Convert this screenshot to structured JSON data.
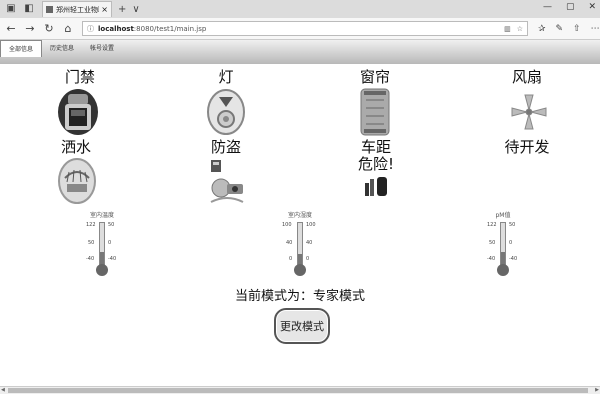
{
  "browser": {
    "tab_title": "郑州轻工业物联网Web...",
    "tab_close": "×",
    "tab_new": "+",
    "tab_menu": "∨",
    "win_min": "—",
    "win_max": "▢",
    "win_close": "✕",
    "url_host": "localhost",
    "url_rest": ":8080/test1/main.jsp"
  },
  "nav": {
    "items": [
      "全部信息",
      "历史信息",
      "帐号设置"
    ]
  },
  "devices": [
    {
      "label": "门禁",
      "icon": "lock-icon"
    },
    {
      "label": "灯",
      "icon": "lightbulb-icon"
    },
    {
      "label": "窗帘",
      "icon": "curtain-icon"
    },
    {
      "label": "风扇",
      "icon": "fan-icon"
    },
    {
      "label": "洒水",
      "icon": "sprinkler-icon"
    },
    {
      "label": "防盗",
      "icon": "burglar-icon"
    },
    {
      "label": "车距",
      "icon": "car-distance-icon",
      "status": "危险!"
    },
    {
      "label": "待开发",
      "icon": ""
    }
  ],
  "gauges": [
    {
      "title": "室内温度",
      "ticks_left": [
        "122",
        "50",
        "-40"
      ],
      "ticks_right": [
        "50",
        "0",
        "-40"
      ],
      "level": 0.35
    },
    {
      "title": "室内湿度",
      "ticks_left": [
        "100",
        "40",
        "0"
      ],
      "ticks_right": [
        "100",
        "40",
        "0"
      ],
      "level": 0.3
    },
    {
      "title": "pM值",
      "ticks_left": [
        "122",
        "50",
        "-40"
      ],
      "ticks_right": [
        "50",
        "0",
        "-40"
      ],
      "level": 0.35
    }
  ],
  "mode": {
    "text": "当前模式为：专家模式",
    "button": "更改模式"
  },
  "colors": {
    "accent": "#777777",
    "header": "#b8b8b8"
  }
}
